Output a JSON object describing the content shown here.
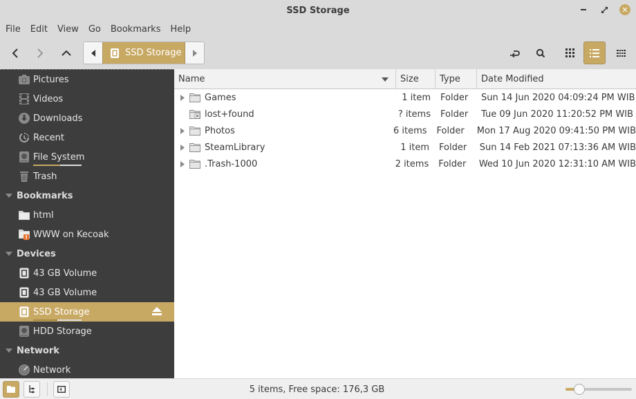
{
  "window": {
    "title": "SSD Storage",
    "accent_color": "#c8a964"
  },
  "menubar": {
    "items": [
      "File",
      "Edit",
      "View",
      "Go",
      "Bookmarks",
      "Help"
    ]
  },
  "toolbar": {
    "back_icon": "chevron-left-icon",
    "forward_icon": "chevron-right-icon",
    "up_icon": "chevron-up-icon",
    "path_current": "SSD Storage",
    "path_icon": "drive-icon",
    "right_tools": [
      "toggle-location-icon",
      "search-icon",
      "icon-view-icon",
      "list-view-icon",
      "compact-view-icon"
    ],
    "active_view": "list-view"
  },
  "sidebar": {
    "places": [
      {
        "label": "Pictures",
        "icon": "camera-icon"
      },
      {
        "label": "Videos",
        "icon": "film-icon"
      },
      {
        "label": "Downloads",
        "icon": "download-icon"
      },
      {
        "label": "Recent",
        "icon": "recent-icon"
      },
      {
        "label": "File System",
        "icon": "harddisk-icon",
        "usage": 0.55
      },
      {
        "label": "Trash",
        "icon": "trash-icon"
      }
    ],
    "bookmarks_header": "Bookmarks",
    "bookmarks": [
      {
        "label": "html",
        "icon": "folder-icon"
      },
      {
        "label": "WWW on Kecoak",
        "icon": "folder-warning-icon"
      }
    ],
    "devices_header": "Devices",
    "devices": [
      {
        "label": "43 GB Volume",
        "icon": "drive-icon"
      },
      {
        "label": "43 GB Volume",
        "icon": "drive-icon"
      },
      {
        "label": "SSD Storage",
        "icon": "drive-icon",
        "selected": true,
        "usage": 0.5,
        "eject": true
      },
      {
        "label": "HDD Storage",
        "icon": "harddisk-icon"
      }
    ],
    "network_header": "Network",
    "network": [
      {
        "label": "Network",
        "icon": "network-icon"
      }
    ]
  },
  "list": {
    "columns": {
      "name": "Name",
      "size": "Size",
      "type": "Type",
      "date": "Date Modified"
    },
    "rows": [
      {
        "name": "Games",
        "size": "1 item",
        "type": "Folder",
        "date": "Sun 14 Jun 2020 04:09:24 PM WIB",
        "expandable": true,
        "icon": "folder-icon"
      },
      {
        "name": "lost+found",
        "size": "? items",
        "type": "Folder",
        "date": "Tue 09 Jun 2020 11:20:52 PM WIB",
        "expandable": false,
        "icon": "folder-locked-icon"
      },
      {
        "name": "Photos",
        "size": "6 items",
        "type": "Folder",
        "date": "Mon 17 Aug 2020 09:41:50 PM WIB",
        "expandable": true,
        "icon": "folder-icon"
      },
      {
        "name": "SteamLibrary",
        "size": "1 item",
        "type": "Folder",
        "date": "Sun 14 Feb 2021 07:13:36 AM WIB",
        "expandable": true,
        "icon": "folder-icon"
      },
      {
        "name": ".Trash-1000",
        "size": "2 items",
        "type": "Folder",
        "date": "Wed 10 Jun 2020 12:31:10 AM WIB",
        "expandable": true,
        "icon": "folder-icon"
      }
    ]
  },
  "statusbar": {
    "text": "5 items, Free space: 176,3 GB",
    "zoom_level": 0.15
  }
}
